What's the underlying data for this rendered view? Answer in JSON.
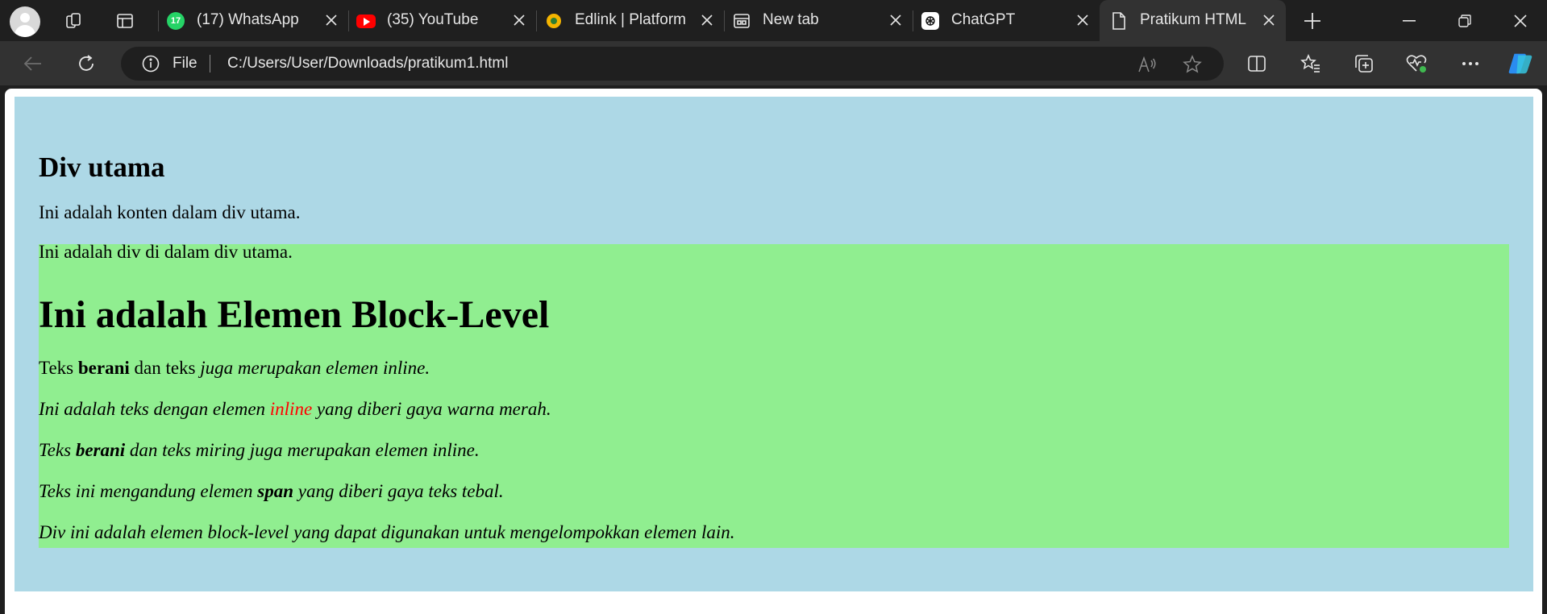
{
  "browser": {
    "tabs": [
      {
        "title": "(17) WhatsApp",
        "badge": "17",
        "icon": "whatsapp-icon"
      },
      {
        "title": "(35) YouTube",
        "icon": "youtube-icon"
      },
      {
        "title": "Edlink | Platform P",
        "icon": "edlink-icon"
      },
      {
        "title": "New tab",
        "icon": "new-tab-icon"
      },
      {
        "title": "ChatGPT",
        "icon": "chatgpt-icon"
      },
      {
        "title": "Pratikum HTML",
        "icon": "file-icon",
        "active": true
      }
    ],
    "address": {
      "scheme": "File",
      "url": "C:/Users/User/Downloads/pratikum1.html"
    }
  },
  "page": {
    "div_utama": {
      "heading": "Div utama",
      "text": "Ini adalah konten dalam div utama.",
      "background": "#add8e6"
    },
    "div_dalam": {
      "background": "#90ee90",
      "intro": "Ini adalah div di dalam div utama.",
      "heading": "Ini adalah Elemen Block-Level",
      "line1": {
        "a": "Teks ",
        "bold": "berani",
        "b": " dan teks ",
        "italic": "juga merupakan elemen inline."
      },
      "line2": {
        "a": "Ini adalah teks dengan elemen ",
        "red": "inline",
        "b": " yang diberi gaya warna merah.",
        "red_color": "#ff0000"
      },
      "line3": {
        "a": "Teks ",
        "bold": "berani",
        "b": " dan teks miring juga merupakan elemen inline."
      },
      "line4": {
        "a": "Teks ini mengandung elemen ",
        "bold": "span",
        "b": " yang diberi gaya teks tebal."
      },
      "line5": "Div ini adalah elemen block-level yang dapat digunakan untuk mengelompokkan elemen lain."
    }
  }
}
